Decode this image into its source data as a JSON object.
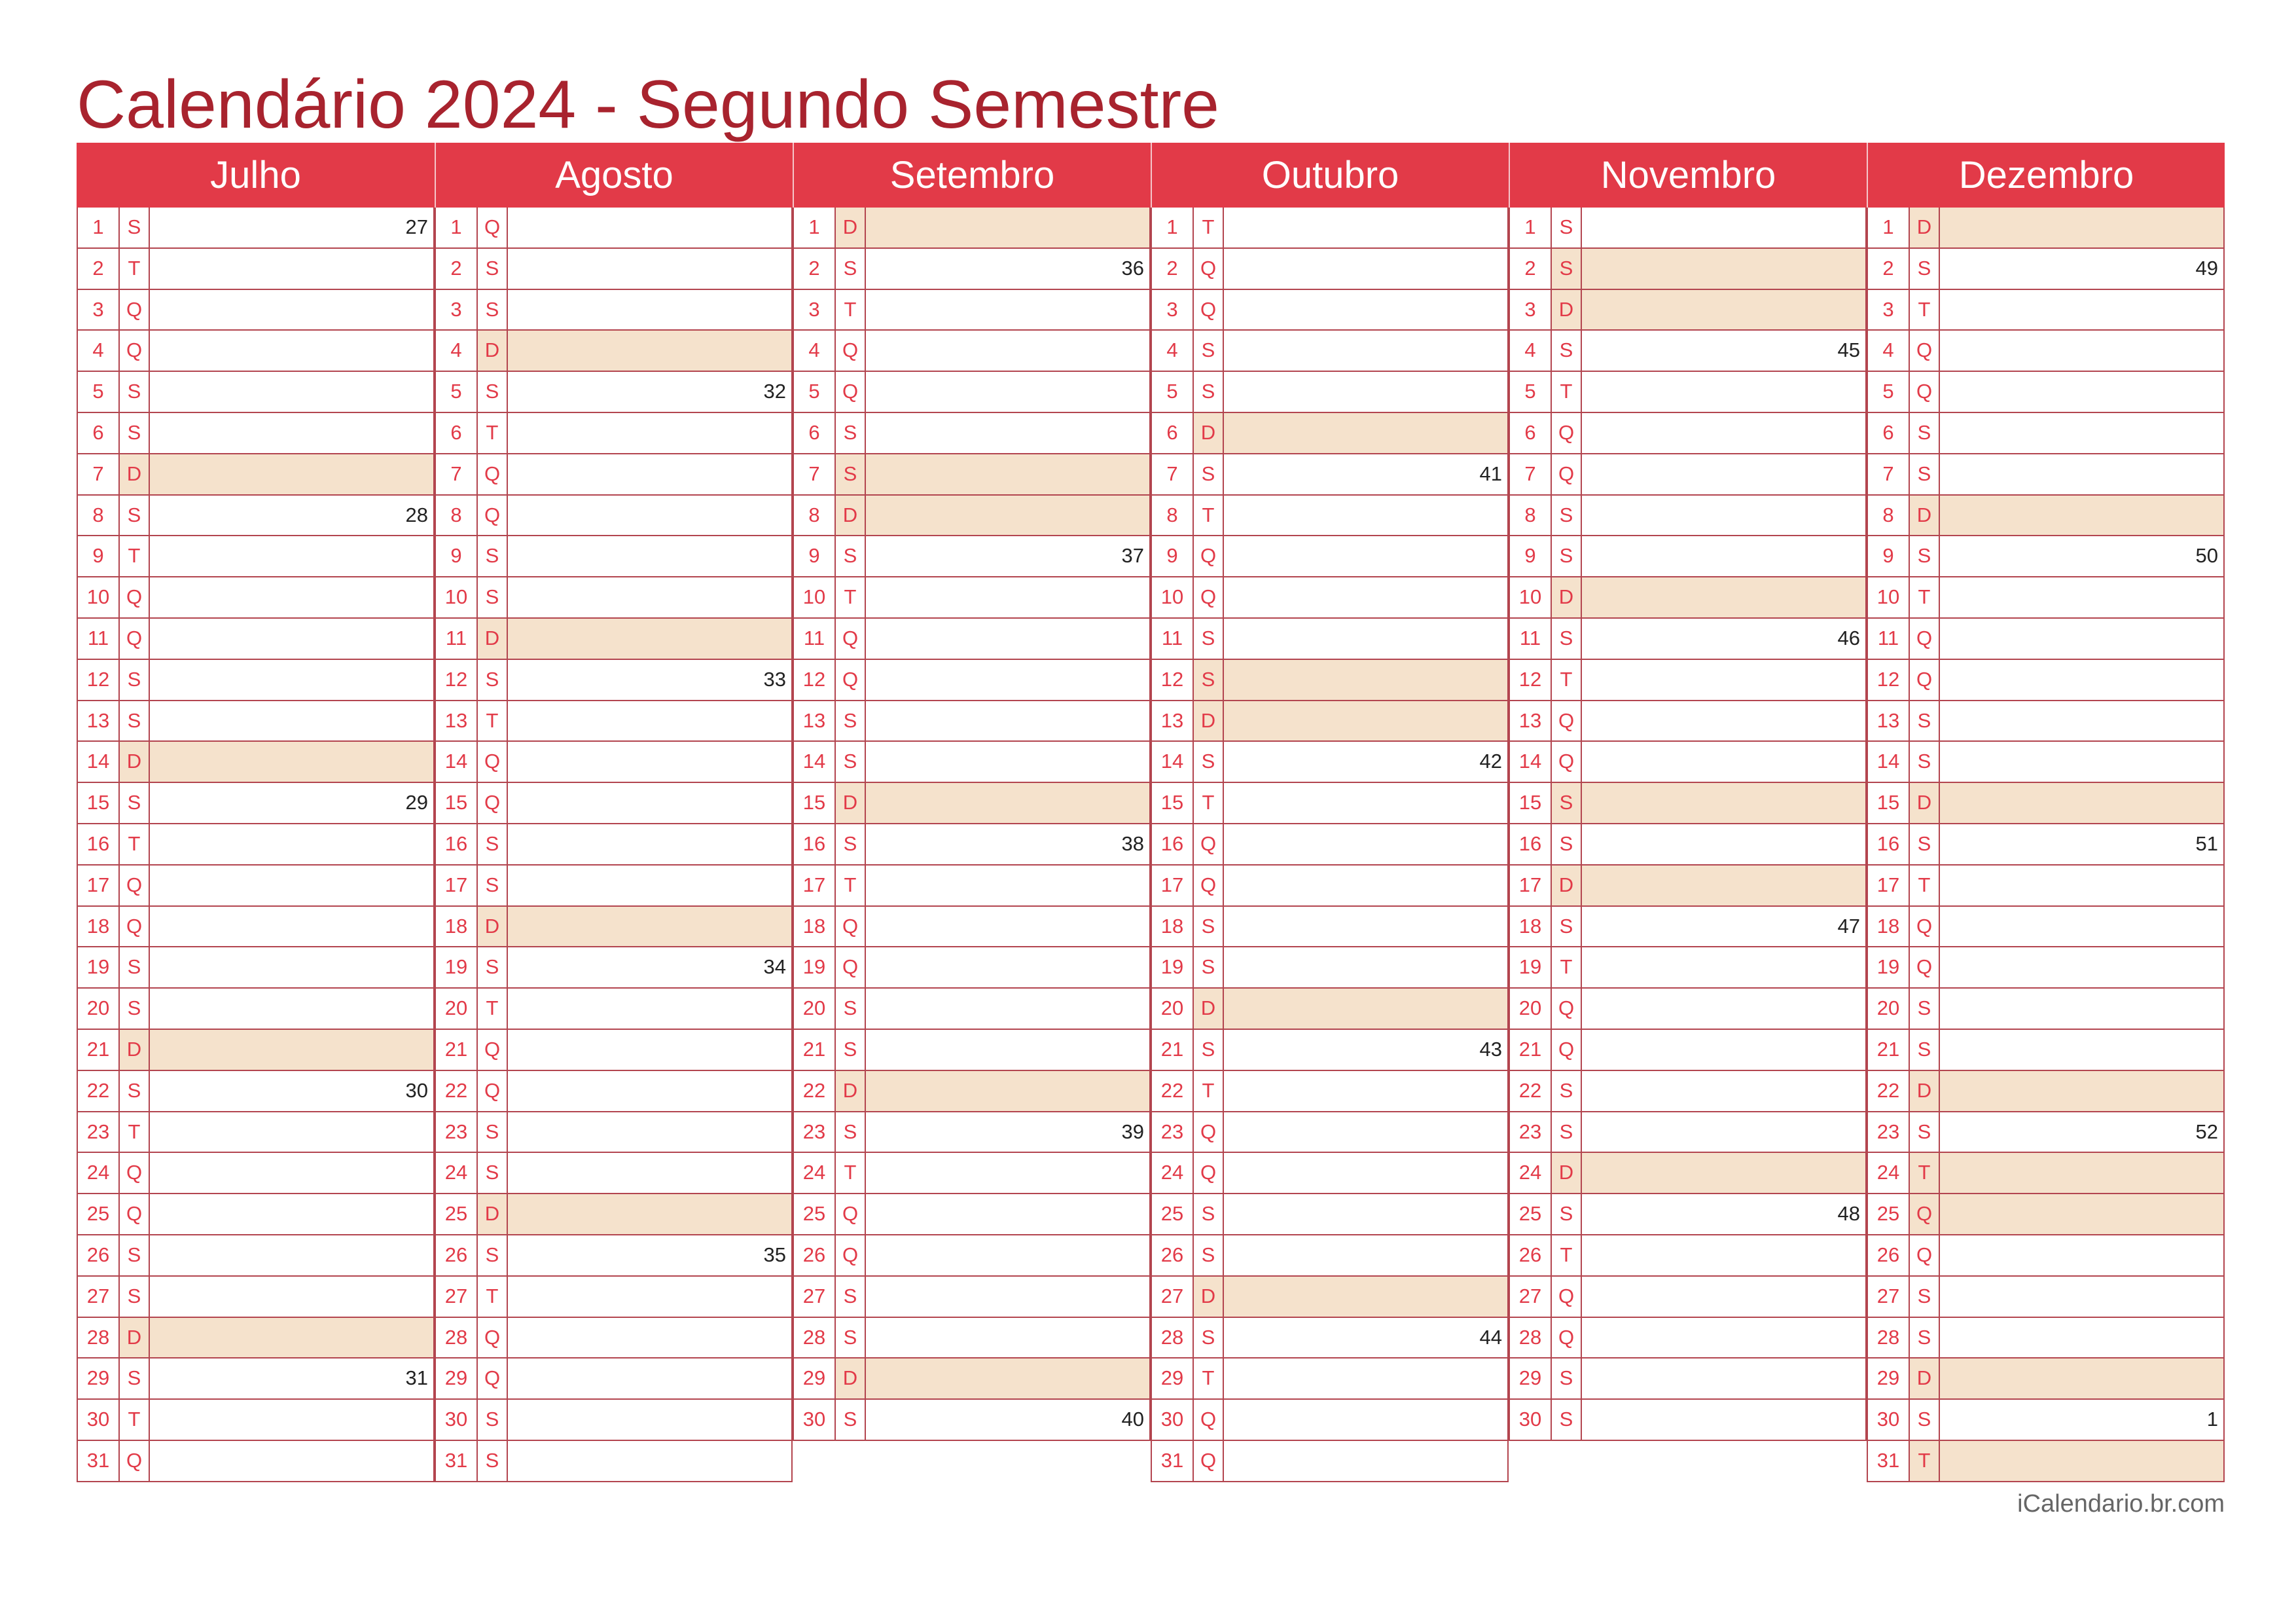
{
  "title": "Calendário 2024 - Segundo Semestre",
  "footer": "iCalendario.br.com",
  "colors": {
    "accent": "#e23a48",
    "title": "#a8232e",
    "weekend": "#f5e2cc",
    "line": "#b3454f"
  },
  "months": [
    {
      "name": "Julho",
      "days": [
        {
          "d": "1",
          "w": "S",
          "n": "27"
        },
        {
          "d": "2",
          "w": "T",
          "n": ""
        },
        {
          "d": "3",
          "w": "Q",
          "n": ""
        },
        {
          "d": "4",
          "w": "Q",
          "n": ""
        },
        {
          "d": "5",
          "w": "S",
          "n": ""
        },
        {
          "d": "6",
          "w": "S",
          "n": ""
        },
        {
          "d": "7",
          "w": "D",
          "n": "",
          "h": true
        },
        {
          "d": "8",
          "w": "S",
          "n": "28"
        },
        {
          "d": "9",
          "w": "T",
          "n": ""
        },
        {
          "d": "10",
          "w": "Q",
          "n": ""
        },
        {
          "d": "11",
          "w": "Q",
          "n": ""
        },
        {
          "d": "12",
          "w": "S",
          "n": ""
        },
        {
          "d": "13",
          "w": "S",
          "n": ""
        },
        {
          "d": "14",
          "w": "D",
          "n": "",
          "h": true
        },
        {
          "d": "15",
          "w": "S",
          "n": "29"
        },
        {
          "d": "16",
          "w": "T",
          "n": ""
        },
        {
          "d": "17",
          "w": "Q",
          "n": ""
        },
        {
          "d": "18",
          "w": "Q",
          "n": ""
        },
        {
          "d": "19",
          "w": "S",
          "n": ""
        },
        {
          "d": "20",
          "w": "S",
          "n": ""
        },
        {
          "d": "21",
          "w": "D",
          "n": "",
          "h": true
        },
        {
          "d": "22",
          "w": "S",
          "n": "30"
        },
        {
          "d": "23",
          "w": "T",
          "n": ""
        },
        {
          "d": "24",
          "w": "Q",
          "n": ""
        },
        {
          "d": "25",
          "w": "Q",
          "n": ""
        },
        {
          "d": "26",
          "w": "S",
          "n": ""
        },
        {
          "d": "27",
          "w": "S",
          "n": ""
        },
        {
          "d": "28",
          "w": "D",
          "n": "",
          "h": true
        },
        {
          "d": "29",
          "w": "S",
          "n": "31"
        },
        {
          "d": "30",
          "w": "T",
          "n": ""
        },
        {
          "d": "31",
          "w": "Q",
          "n": ""
        }
      ]
    },
    {
      "name": "Agosto",
      "days": [
        {
          "d": "1",
          "w": "Q",
          "n": ""
        },
        {
          "d": "2",
          "w": "S",
          "n": ""
        },
        {
          "d": "3",
          "w": "S",
          "n": ""
        },
        {
          "d": "4",
          "w": "D",
          "n": "",
          "h": true
        },
        {
          "d": "5",
          "w": "S",
          "n": "32"
        },
        {
          "d": "6",
          "w": "T",
          "n": ""
        },
        {
          "d": "7",
          "w": "Q",
          "n": ""
        },
        {
          "d": "8",
          "w": "Q",
          "n": ""
        },
        {
          "d": "9",
          "w": "S",
          "n": ""
        },
        {
          "d": "10",
          "w": "S",
          "n": ""
        },
        {
          "d": "11",
          "w": "D",
          "n": "",
          "h": true
        },
        {
          "d": "12",
          "w": "S",
          "n": "33"
        },
        {
          "d": "13",
          "w": "T",
          "n": ""
        },
        {
          "d": "14",
          "w": "Q",
          "n": ""
        },
        {
          "d": "15",
          "w": "Q",
          "n": ""
        },
        {
          "d": "16",
          "w": "S",
          "n": ""
        },
        {
          "d": "17",
          "w": "S",
          "n": ""
        },
        {
          "d": "18",
          "w": "D",
          "n": "",
          "h": true
        },
        {
          "d": "19",
          "w": "S",
          "n": "34"
        },
        {
          "d": "20",
          "w": "T",
          "n": ""
        },
        {
          "d": "21",
          "w": "Q",
          "n": ""
        },
        {
          "d": "22",
          "w": "Q",
          "n": ""
        },
        {
          "d": "23",
          "w": "S",
          "n": ""
        },
        {
          "d": "24",
          "w": "S",
          "n": ""
        },
        {
          "d": "25",
          "w": "D",
          "n": "",
          "h": true
        },
        {
          "d": "26",
          "w": "S",
          "n": "35"
        },
        {
          "d": "27",
          "w": "T",
          "n": ""
        },
        {
          "d": "28",
          "w": "Q",
          "n": ""
        },
        {
          "d": "29",
          "w": "Q",
          "n": ""
        },
        {
          "d": "30",
          "w": "S",
          "n": ""
        },
        {
          "d": "31",
          "w": "S",
          "n": ""
        }
      ]
    },
    {
      "name": "Setembro",
      "days": [
        {
          "d": "1",
          "w": "D",
          "n": "",
          "h": true
        },
        {
          "d": "2",
          "w": "S",
          "n": "36"
        },
        {
          "d": "3",
          "w": "T",
          "n": ""
        },
        {
          "d": "4",
          "w": "Q",
          "n": ""
        },
        {
          "d": "5",
          "w": "Q",
          "n": ""
        },
        {
          "d": "6",
          "w": "S",
          "n": ""
        },
        {
          "d": "7",
          "w": "S",
          "n": "",
          "h": true
        },
        {
          "d": "8",
          "w": "D",
          "n": "",
          "h": true
        },
        {
          "d": "9",
          "w": "S",
          "n": "37"
        },
        {
          "d": "10",
          "w": "T",
          "n": ""
        },
        {
          "d": "11",
          "w": "Q",
          "n": ""
        },
        {
          "d": "12",
          "w": "Q",
          "n": ""
        },
        {
          "d": "13",
          "w": "S",
          "n": ""
        },
        {
          "d": "14",
          "w": "S",
          "n": ""
        },
        {
          "d": "15",
          "w": "D",
          "n": "",
          "h": true
        },
        {
          "d": "16",
          "w": "S",
          "n": "38"
        },
        {
          "d": "17",
          "w": "T",
          "n": ""
        },
        {
          "d": "18",
          "w": "Q",
          "n": ""
        },
        {
          "d": "19",
          "w": "Q",
          "n": ""
        },
        {
          "d": "20",
          "w": "S",
          "n": ""
        },
        {
          "d": "21",
          "w": "S",
          "n": ""
        },
        {
          "d": "22",
          "w": "D",
          "n": "",
          "h": true
        },
        {
          "d": "23",
          "w": "S",
          "n": "39"
        },
        {
          "d": "24",
          "w": "T",
          "n": ""
        },
        {
          "d": "25",
          "w": "Q",
          "n": ""
        },
        {
          "d": "26",
          "w": "Q",
          "n": ""
        },
        {
          "d": "27",
          "w": "S",
          "n": ""
        },
        {
          "d": "28",
          "w": "S",
          "n": ""
        },
        {
          "d": "29",
          "w": "D",
          "n": "",
          "h": true
        },
        {
          "d": "30",
          "w": "S",
          "n": "40"
        }
      ]
    },
    {
      "name": "Outubro",
      "days": [
        {
          "d": "1",
          "w": "T",
          "n": ""
        },
        {
          "d": "2",
          "w": "Q",
          "n": ""
        },
        {
          "d": "3",
          "w": "Q",
          "n": ""
        },
        {
          "d": "4",
          "w": "S",
          "n": ""
        },
        {
          "d": "5",
          "w": "S",
          "n": ""
        },
        {
          "d": "6",
          "w": "D",
          "n": "",
          "h": true
        },
        {
          "d": "7",
          "w": "S",
          "n": "41"
        },
        {
          "d": "8",
          "w": "T",
          "n": ""
        },
        {
          "d": "9",
          "w": "Q",
          "n": ""
        },
        {
          "d": "10",
          "w": "Q",
          "n": ""
        },
        {
          "d": "11",
          "w": "S",
          "n": ""
        },
        {
          "d": "12",
          "w": "S",
          "n": "",
          "h": true
        },
        {
          "d": "13",
          "w": "D",
          "n": "",
          "h": true
        },
        {
          "d": "14",
          "w": "S",
          "n": "42"
        },
        {
          "d": "15",
          "w": "T",
          "n": ""
        },
        {
          "d": "16",
          "w": "Q",
          "n": ""
        },
        {
          "d": "17",
          "w": "Q",
          "n": ""
        },
        {
          "d": "18",
          "w": "S",
          "n": ""
        },
        {
          "d": "19",
          "w": "S",
          "n": ""
        },
        {
          "d": "20",
          "w": "D",
          "n": "",
          "h": true
        },
        {
          "d": "21",
          "w": "S",
          "n": "43"
        },
        {
          "d": "22",
          "w": "T",
          "n": ""
        },
        {
          "d": "23",
          "w": "Q",
          "n": ""
        },
        {
          "d": "24",
          "w": "Q",
          "n": ""
        },
        {
          "d": "25",
          "w": "S",
          "n": ""
        },
        {
          "d": "26",
          "w": "S",
          "n": ""
        },
        {
          "d": "27",
          "w": "D",
          "n": "",
          "h": true
        },
        {
          "d": "28",
          "w": "S",
          "n": "44"
        },
        {
          "d": "29",
          "w": "T",
          "n": ""
        },
        {
          "d": "30",
          "w": "Q",
          "n": ""
        },
        {
          "d": "31",
          "w": "Q",
          "n": ""
        }
      ]
    },
    {
      "name": "Novembro",
      "days": [
        {
          "d": "1",
          "w": "S",
          "n": ""
        },
        {
          "d": "2",
          "w": "S",
          "n": "",
          "h": true
        },
        {
          "d": "3",
          "w": "D",
          "n": "",
          "h": true
        },
        {
          "d": "4",
          "w": "S",
          "n": "45"
        },
        {
          "d": "5",
          "w": "T",
          "n": ""
        },
        {
          "d": "6",
          "w": "Q",
          "n": ""
        },
        {
          "d": "7",
          "w": "Q",
          "n": ""
        },
        {
          "d": "8",
          "w": "S",
          "n": ""
        },
        {
          "d": "9",
          "w": "S",
          "n": ""
        },
        {
          "d": "10",
          "w": "D",
          "n": "",
          "h": true
        },
        {
          "d": "11",
          "w": "S",
          "n": "46"
        },
        {
          "d": "12",
          "w": "T",
          "n": ""
        },
        {
          "d": "13",
          "w": "Q",
          "n": ""
        },
        {
          "d": "14",
          "w": "Q",
          "n": ""
        },
        {
          "d": "15",
          "w": "S",
          "n": "",
          "h": true
        },
        {
          "d": "16",
          "w": "S",
          "n": ""
        },
        {
          "d": "17",
          "w": "D",
          "n": "",
          "h": true
        },
        {
          "d": "18",
          "w": "S",
          "n": "47"
        },
        {
          "d": "19",
          "w": "T",
          "n": ""
        },
        {
          "d": "20",
          "w": "Q",
          "n": ""
        },
        {
          "d": "21",
          "w": "Q",
          "n": ""
        },
        {
          "d": "22",
          "w": "S",
          "n": ""
        },
        {
          "d": "23",
          "w": "S",
          "n": ""
        },
        {
          "d": "24",
          "w": "D",
          "n": "",
          "h": true
        },
        {
          "d": "25",
          "w": "S",
          "n": "48"
        },
        {
          "d": "26",
          "w": "T",
          "n": ""
        },
        {
          "d": "27",
          "w": "Q",
          "n": ""
        },
        {
          "d": "28",
          "w": "Q",
          "n": ""
        },
        {
          "d": "29",
          "w": "S",
          "n": ""
        },
        {
          "d": "30",
          "w": "S",
          "n": ""
        }
      ]
    },
    {
      "name": "Dezembro",
      "days": [
        {
          "d": "1",
          "w": "D",
          "n": "",
          "h": true
        },
        {
          "d": "2",
          "w": "S",
          "n": "49"
        },
        {
          "d": "3",
          "w": "T",
          "n": ""
        },
        {
          "d": "4",
          "w": "Q",
          "n": ""
        },
        {
          "d": "5",
          "w": "Q",
          "n": ""
        },
        {
          "d": "6",
          "w": "S",
          "n": ""
        },
        {
          "d": "7",
          "w": "S",
          "n": ""
        },
        {
          "d": "8",
          "w": "D",
          "n": "",
          "h": true
        },
        {
          "d": "9",
          "w": "S",
          "n": "50"
        },
        {
          "d": "10",
          "w": "T",
          "n": ""
        },
        {
          "d": "11",
          "w": "Q",
          "n": ""
        },
        {
          "d": "12",
          "w": "Q",
          "n": ""
        },
        {
          "d": "13",
          "w": "S",
          "n": ""
        },
        {
          "d": "14",
          "w": "S",
          "n": ""
        },
        {
          "d": "15",
          "w": "D",
          "n": "",
          "h": true
        },
        {
          "d": "16",
          "w": "S",
          "n": "51"
        },
        {
          "d": "17",
          "w": "T",
          "n": ""
        },
        {
          "d": "18",
          "w": "Q",
          "n": ""
        },
        {
          "d": "19",
          "w": "Q",
          "n": ""
        },
        {
          "d": "20",
          "w": "S",
          "n": ""
        },
        {
          "d": "21",
          "w": "S",
          "n": ""
        },
        {
          "d": "22",
          "w": "D",
          "n": "",
          "h": true
        },
        {
          "d": "23",
          "w": "S",
          "n": "52"
        },
        {
          "d": "24",
          "w": "T",
          "n": "",
          "h": true
        },
        {
          "d": "25",
          "w": "Q",
          "n": "",
          "h": true
        },
        {
          "d": "26",
          "w": "Q",
          "n": ""
        },
        {
          "d": "27",
          "w": "S",
          "n": ""
        },
        {
          "d": "28",
          "w": "S",
          "n": ""
        },
        {
          "d": "29",
          "w": "D",
          "n": "",
          "h": true
        },
        {
          "d": "30",
          "w": "S",
          "n": "1"
        },
        {
          "d": "31",
          "w": "T",
          "n": "",
          "h": true
        }
      ]
    }
  ]
}
